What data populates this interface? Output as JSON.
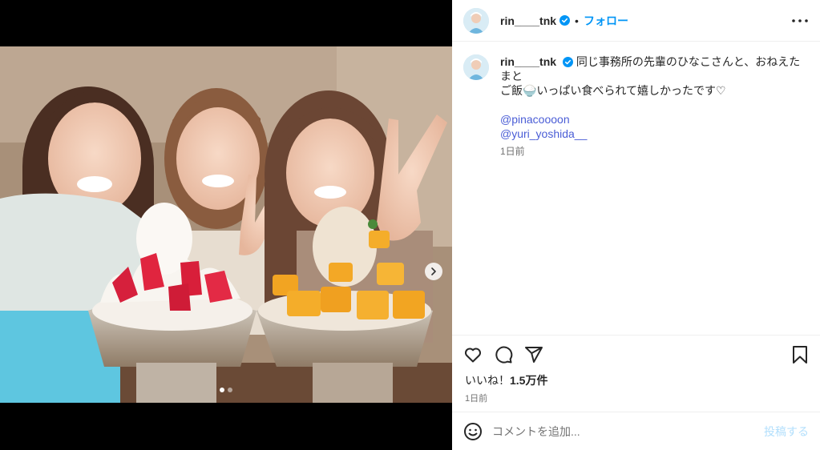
{
  "post": {
    "username": "rin____tnk",
    "follow_label": "フォロー",
    "separator": "•"
  },
  "caption": {
    "username": "rin____tnk",
    "text_line1": "同じ事務所の先輩のひなこさんと、おねえたまと",
    "text_line2": "ご飯🍚いっぱい食べられて嬉しかったです♡",
    "mentions": [
      "@pinacoooon",
      "@yuri_yoshida__"
    ],
    "time_ago": "1日前"
  },
  "engagement": {
    "likes_label": "いいね！",
    "likes_count": "1.5万件",
    "date": "1日前"
  },
  "comment": {
    "placeholder": "コメントを追加...",
    "post_label": "投稿する"
  },
  "carousel": {
    "total_images": 2,
    "current_index": 1
  },
  "icons": {
    "header_more": "more-horizontal-icon",
    "like": "heart-icon",
    "comment": "comment-icon",
    "share": "paper-plane-icon",
    "save": "bookmark-icon",
    "emoji": "emoji-icon",
    "next": "chevron-right-icon",
    "verified": "verified-badge-icon"
  },
  "colors": {
    "link_blue": "#0095f6",
    "mention_blue": "#4a5dd6",
    "muted_text": "#737373",
    "border": "#efefef"
  }
}
